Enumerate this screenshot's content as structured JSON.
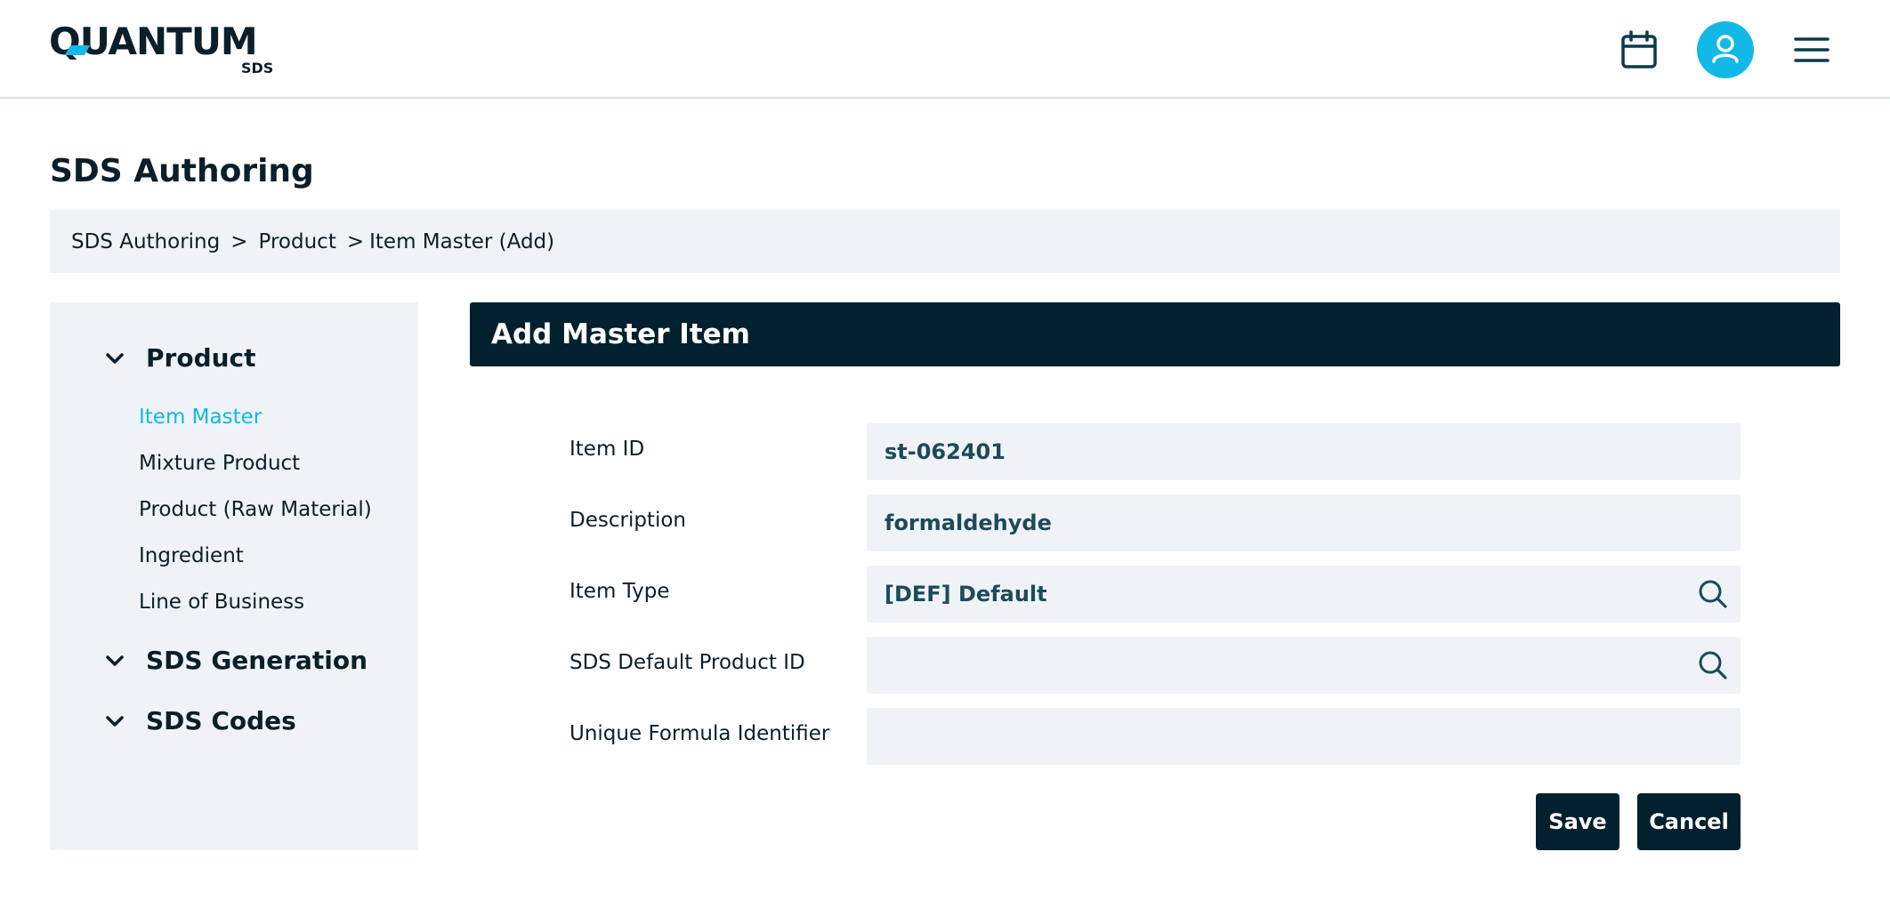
{
  "brand": {
    "name": "QUANTUM",
    "sub": "SDS",
    "accent": "#12b9e6",
    "dark": "#02202e"
  },
  "header": {
    "icons": [
      "calendar-icon",
      "user-icon",
      "hamburger-menu-icon"
    ]
  },
  "page_title": "SDS Authoring",
  "breadcrumb": [
    "SDS Authoring",
    "Product",
    "Item Master (Add)"
  ],
  "sidebar": {
    "sections": [
      {
        "label": "Product",
        "expanded_icon": "chevron-down-icon",
        "items": [
          {
            "label": "Item Master",
            "active": true
          },
          {
            "label": "Mixture Product"
          },
          {
            "label": "Product (Raw Material)"
          },
          {
            "label": "Ingredient"
          },
          {
            "label": "Line of Business"
          }
        ]
      },
      {
        "label": "SDS Generation",
        "expanded_icon": "chevron-down-icon"
      },
      {
        "label": "SDS Codes",
        "expanded_icon": "chevron-down-icon"
      }
    ]
  },
  "form": {
    "title": "Add Master Item",
    "fields": [
      {
        "label": "Item ID",
        "value": "st-062401"
      },
      {
        "label": "Description",
        "value": "formaldehyde"
      },
      {
        "label": "Item Type",
        "value": "[DEF] Default",
        "icon": "search-icon"
      },
      {
        "label": "SDS Default Product ID",
        "value": "",
        "icon": "search-icon"
      },
      {
        "label": "Unique Formula Identifier",
        "value": ""
      }
    ],
    "save_label": "Save",
    "cancel_label": "Cancel"
  }
}
